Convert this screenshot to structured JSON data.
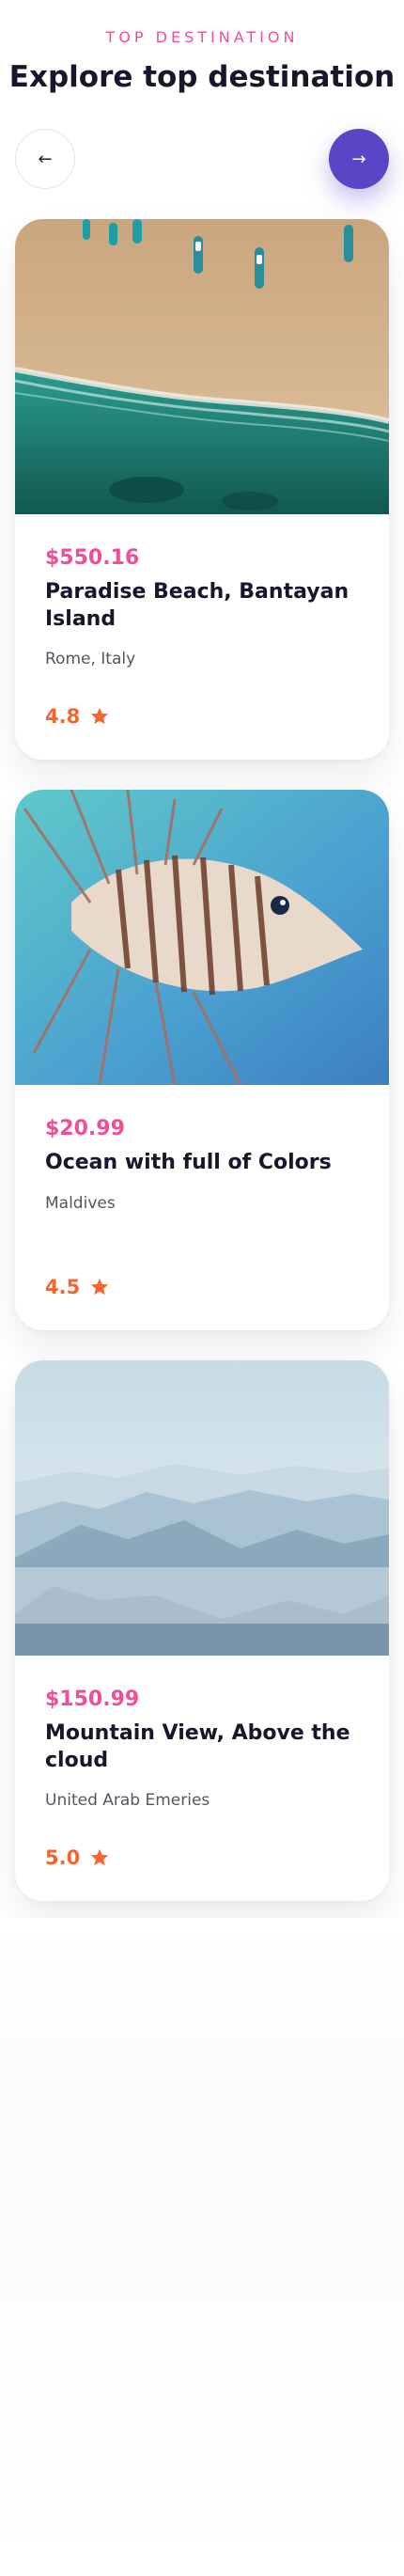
{
  "header": {
    "eyebrow": "TOP DESTINATION",
    "title": "Explore top destination"
  },
  "nav": {
    "prev_icon": "arrow-left-icon",
    "next_icon": "arrow-right-icon",
    "prev_glyph": "←",
    "next_glyph": "→",
    "accent": "#5b45c6"
  },
  "cards": [
    {
      "image": "beach-aerial-photo",
      "price": "$550.16",
      "title": "Paradise Beach, Bantayan Island",
      "location": "Rome, Italy",
      "rating": "4.8"
    },
    {
      "image": "lionfish-photo",
      "price": "$20.99",
      "title": "Ocean with full of Colors",
      "location": "Maldives",
      "rating": "4.5"
    },
    {
      "image": "misty-mountains-photo",
      "price": "$150.99",
      "title": "Mountain View, Above the cloud",
      "location": "United Arab Emeries",
      "rating": "5.0"
    }
  ],
  "colors": {
    "price": "#f04f97",
    "rating": "#f6652f",
    "title": "#17162a"
  }
}
